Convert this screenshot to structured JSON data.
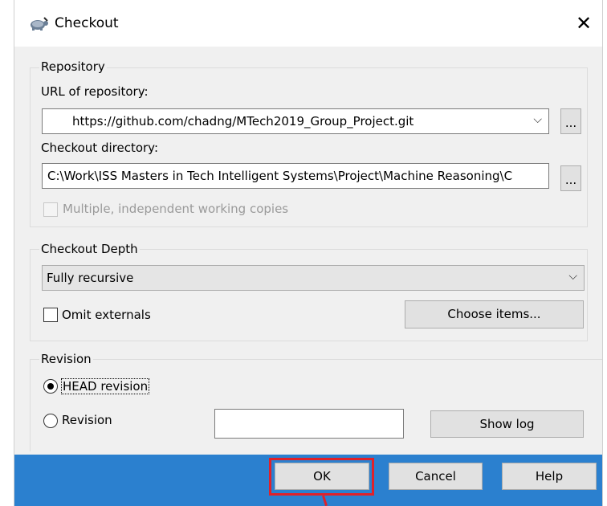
{
  "window": {
    "title": "Checkout",
    "close_glyph": "✕"
  },
  "repository": {
    "legend": "Repository",
    "url_label": "URL of repository:",
    "url_value": "https://github.com/chadng/MTech2019_Group_Project.git",
    "browse_url_label": "...",
    "dir_label": "Checkout directory:",
    "dir_value": "C:\\Work\\ISS Masters in Tech Intelligent Systems\\Project\\Machine Reasoning\\C",
    "browse_dir_label": "...",
    "multiple_label": "Multiple, independent working copies"
  },
  "depth": {
    "legend": "Checkout Depth",
    "selected": "Fully recursive",
    "omit_externals_label": "Omit externals",
    "choose_items_label": "Choose items..."
  },
  "revision": {
    "legend": "Revision",
    "head_label": "HEAD revision",
    "revision_label": "Revision",
    "revision_value": "",
    "show_log_label": "Show log"
  },
  "footer": {
    "ok_label": "OK",
    "cancel_label": "Cancel",
    "help_label": "Help"
  },
  "colors": {
    "footer": "#2b80cf",
    "highlight": "#e0212a"
  }
}
